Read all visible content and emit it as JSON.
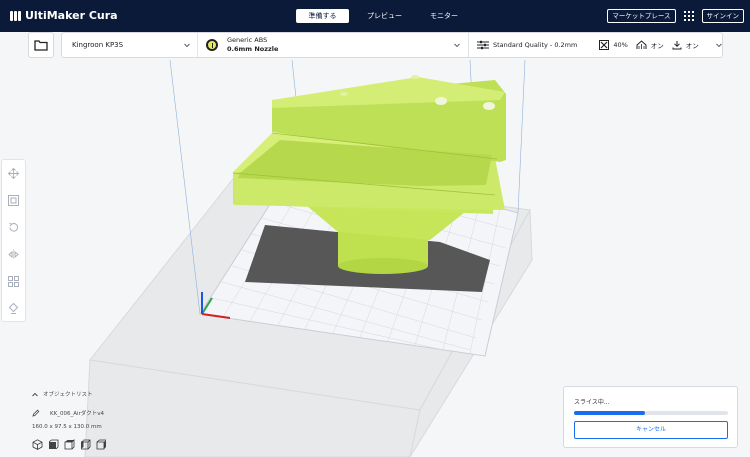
{
  "app": {
    "title": "UltiMaker Cura"
  },
  "header": {
    "stages": [
      {
        "label": "準備する",
        "active": true
      },
      {
        "label": "プレビュー",
        "active": false
      },
      {
        "label": "モニター",
        "active": false
      }
    ],
    "marketplace_label": "マーケットプレース",
    "apps_icon": "grid-icon",
    "signin_label": "サインイン"
  },
  "toolbar": {
    "open_icon": "folder-icon",
    "printer": "Kingroon KP3S",
    "material": {
      "name": "Generic ABS",
      "nozzle": "0.6mm Nozzle",
      "color": "#e4ea63"
    },
    "profile": {
      "quality": "Standard Quality - 0.2mm",
      "infill": "40%",
      "support": "オン",
      "adhesion": "オン"
    }
  },
  "left_tools": [
    {
      "icon": "move-icon"
    },
    {
      "icon": "scale-icon"
    },
    {
      "icon": "rotate-icon"
    },
    {
      "icon": "mirror-icon"
    },
    {
      "icon": "per-model-settings-icon"
    },
    {
      "icon": "support-blocker-icon"
    }
  ],
  "object_list": {
    "header": "オブジェクトリスト",
    "item": "KK_006_Airダクトv4",
    "dimensions": "160.0 x 97.5 x 130.0 mm",
    "view_icons": [
      "3d-view-icon",
      "front-view-icon",
      "top-view-icon",
      "left-view-icon",
      "right-view-icon"
    ]
  },
  "slice_panel": {
    "status": "スライス中...",
    "progress": 0.46,
    "cancel_label": "キャンセル",
    "accent": "#196ef0"
  },
  "colors": {
    "header_bg": "#0c1a3a",
    "model": "#c8e85c",
    "plate_shadow": "#555555"
  }
}
